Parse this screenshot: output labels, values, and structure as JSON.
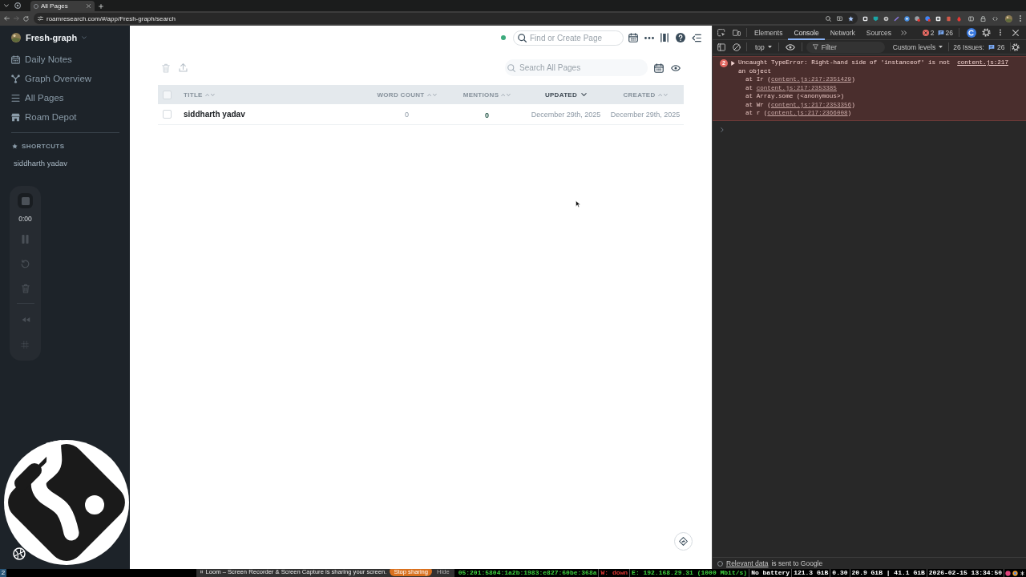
{
  "browser": {
    "tabs": [
      {
        "title": "All Pages",
        "selected": true
      }
    ],
    "url": "roamresearch.com/#/app/Fresh-graph/search"
  },
  "sidebar": {
    "graph_name": "Fresh-graph",
    "nav": [
      {
        "label": "Daily Notes"
      },
      {
        "label": "Graph Overview"
      },
      {
        "label": "All Pages"
      },
      {
        "label": "Roam Depot"
      }
    ],
    "shortcuts_title": "SHORTCUTS",
    "shortcuts": [
      {
        "label": "siddharth yadav"
      }
    ]
  },
  "recorder": {
    "time": "0:00"
  },
  "topbar": {
    "search": {
      "placeholder": "Find or Create Page"
    }
  },
  "all_pages": {
    "search": {
      "placeholder": "Search All Pages"
    },
    "table": {
      "select_all_checked": false,
      "columns": [
        {
          "label": "TITLE",
          "sorted": false
        },
        {
          "label": "WORD COUNT",
          "sorted": false
        },
        {
          "label": "MENTIONS",
          "sorted": false
        },
        {
          "label": "UPDATED",
          "sorted": true
        },
        {
          "label": "CREATED",
          "sorted": false
        }
      ],
      "rows": [
        {
          "checked": false,
          "cells": [
            "siddharth yadav",
            "0",
            "0",
            "December 29th, 2025",
            "December 29th, 2025"
          ]
        }
      ]
    }
  },
  "devtools": {
    "tabs": [
      {
        "label": "Elements",
        "selected": false
      },
      {
        "label": "Console",
        "selected": true
      },
      {
        "label": "Network",
        "selected": false
      },
      {
        "label": "Sources",
        "selected": false
      }
    ],
    "error_count": "2",
    "message_count": "26",
    "context": "top",
    "filter": {
      "placeholder": "Filter"
    },
    "levels": "Custom levels",
    "issues_label": "26 Issues:",
    "issues_count": "26",
    "messages": [
      {
        "kind": "error",
        "count": "2",
        "expanded": false,
        "text": "Uncaught TypeError: Right-hand side of 'instanceof' is not an object",
        "source": "content.js:217",
        "stack": [
          {
            "text": "at Ir (",
            "link": "content.js:217:2351429",
            "after": ")"
          },
          {
            "text": "at ",
            "link": "content.js:217:2353385"
          },
          {
            "text": "at Array.some (<anonymous>)"
          },
          {
            "text": "at Wr (",
            "link": "content.js:217:2353356",
            "after": ")"
          },
          {
            "text": "at r (",
            "link": "content.js:217:2366008",
            "after": ")"
          }
        ]
      }
    ],
    "footer": {
      "link": "Relevant data",
      "text": "is sent to Google"
    }
  },
  "taskbar": {
    "workspace": "2",
    "sharing": {
      "text": "Loom – Screen Recorder & Screen Capture is sharing your screen.",
      "stop": "Stop sharing",
      "hide": "Hide"
    },
    "status": [
      {
        "text": "05:201:5804:1a2b:1983:e827:60be:368a",
        "color": "#3fd43f"
      },
      {
        "text": "W: down",
        "color": "#e53935"
      },
      {
        "text": "E: 192.168.29.31 (1000 Mbit/s)",
        "color": "#3fd43f"
      },
      {
        "text": "No battery",
        "color": "#ffffff"
      },
      {
        "text": "121.3 GiB",
        "color": "#ffffff"
      },
      {
        "text": "0.30",
        "color": "#ffffff"
      },
      {
        "text": "20.9 GiB | 41.1 GiB",
        "color": "#ffffff"
      },
      {
        "text": "2026-02-15 13:34:50",
        "color": "#ffffff"
      }
    ]
  }
}
